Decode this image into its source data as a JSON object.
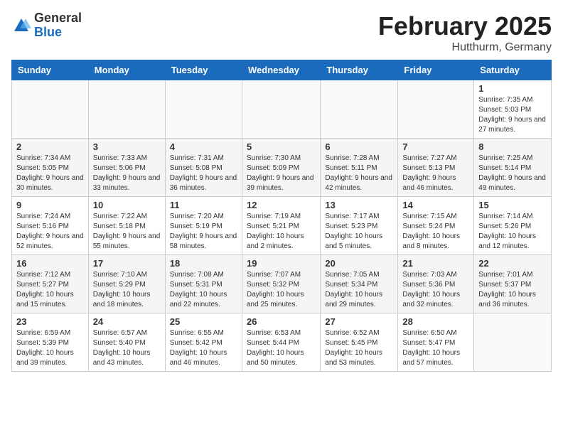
{
  "logo": {
    "general": "General",
    "blue": "Blue"
  },
  "title": "February 2025",
  "location": "Hutthurm, Germany",
  "days_of_week": [
    "Sunday",
    "Monday",
    "Tuesday",
    "Wednesday",
    "Thursday",
    "Friday",
    "Saturday"
  ],
  "weeks": [
    [
      {
        "day": "",
        "info": ""
      },
      {
        "day": "",
        "info": ""
      },
      {
        "day": "",
        "info": ""
      },
      {
        "day": "",
        "info": ""
      },
      {
        "day": "",
        "info": ""
      },
      {
        "day": "",
        "info": ""
      },
      {
        "day": "1",
        "info": "Sunrise: 7:35 AM\nSunset: 5:03 PM\nDaylight: 9 hours and 27 minutes."
      }
    ],
    [
      {
        "day": "2",
        "info": "Sunrise: 7:34 AM\nSunset: 5:05 PM\nDaylight: 9 hours and 30 minutes."
      },
      {
        "day": "3",
        "info": "Sunrise: 7:33 AM\nSunset: 5:06 PM\nDaylight: 9 hours and 33 minutes."
      },
      {
        "day": "4",
        "info": "Sunrise: 7:31 AM\nSunset: 5:08 PM\nDaylight: 9 hours and 36 minutes."
      },
      {
        "day": "5",
        "info": "Sunrise: 7:30 AM\nSunset: 5:09 PM\nDaylight: 9 hours and 39 minutes."
      },
      {
        "day": "6",
        "info": "Sunrise: 7:28 AM\nSunset: 5:11 PM\nDaylight: 9 hours and 42 minutes."
      },
      {
        "day": "7",
        "info": "Sunrise: 7:27 AM\nSunset: 5:13 PM\nDaylight: 9 hours and 46 minutes."
      },
      {
        "day": "8",
        "info": "Sunrise: 7:25 AM\nSunset: 5:14 PM\nDaylight: 9 hours and 49 minutes."
      }
    ],
    [
      {
        "day": "9",
        "info": "Sunrise: 7:24 AM\nSunset: 5:16 PM\nDaylight: 9 hours and 52 minutes."
      },
      {
        "day": "10",
        "info": "Sunrise: 7:22 AM\nSunset: 5:18 PM\nDaylight: 9 hours and 55 minutes."
      },
      {
        "day": "11",
        "info": "Sunrise: 7:20 AM\nSunset: 5:19 PM\nDaylight: 9 hours and 58 minutes."
      },
      {
        "day": "12",
        "info": "Sunrise: 7:19 AM\nSunset: 5:21 PM\nDaylight: 10 hours and 2 minutes."
      },
      {
        "day": "13",
        "info": "Sunrise: 7:17 AM\nSunset: 5:23 PM\nDaylight: 10 hours and 5 minutes."
      },
      {
        "day": "14",
        "info": "Sunrise: 7:15 AM\nSunset: 5:24 PM\nDaylight: 10 hours and 8 minutes."
      },
      {
        "day": "15",
        "info": "Sunrise: 7:14 AM\nSunset: 5:26 PM\nDaylight: 10 hours and 12 minutes."
      }
    ],
    [
      {
        "day": "16",
        "info": "Sunrise: 7:12 AM\nSunset: 5:27 PM\nDaylight: 10 hours and 15 minutes."
      },
      {
        "day": "17",
        "info": "Sunrise: 7:10 AM\nSunset: 5:29 PM\nDaylight: 10 hours and 18 minutes."
      },
      {
        "day": "18",
        "info": "Sunrise: 7:08 AM\nSunset: 5:31 PM\nDaylight: 10 hours and 22 minutes."
      },
      {
        "day": "19",
        "info": "Sunrise: 7:07 AM\nSunset: 5:32 PM\nDaylight: 10 hours and 25 minutes."
      },
      {
        "day": "20",
        "info": "Sunrise: 7:05 AM\nSunset: 5:34 PM\nDaylight: 10 hours and 29 minutes."
      },
      {
        "day": "21",
        "info": "Sunrise: 7:03 AM\nSunset: 5:36 PM\nDaylight: 10 hours and 32 minutes."
      },
      {
        "day": "22",
        "info": "Sunrise: 7:01 AM\nSunset: 5:37 PM\nDaylight: 10 hours and 36 minutes."
      }
    ],
    [
      {
        "day": "23",
        "info": "Sunrise: 6:59 AM\nSunset: 5:39 PM\nDaylight: 10 hours and 39 minutes."
      },
      {
        "day": "24",
        "info": "Sunrise: 6:57 AM\nSunset: 5:40 PM\nDaylight: 10 hours and 43 minutes."
      },
      {
        "day": "25",
        "info": "Sunrise: 6:55 AM\nSunset: 5:42 PM\nDaylight: 10 hours and 46 minutes."
      },
      {
        "day": "26",
        "info": "Sunrise: 6:53 AM\nSunset: 5:44 PM\nDaylight: 10 hours and 50 minutes."
      },
      {
        "day": "27",
        "info": "Sunrise: 6:52 AM\nSunset: 5:45 PM\nDaylight: 10 hours and 53 minutes."
      },
      {
        "day": "28",
        "info": "Sunrise: 6:50 AM\nSunset: 5:47 PM\nDaylight: 10 hours and 57 minutes."
      },
      {
        "day": "",
        "info": ""
      }
    ]
  ]
}
